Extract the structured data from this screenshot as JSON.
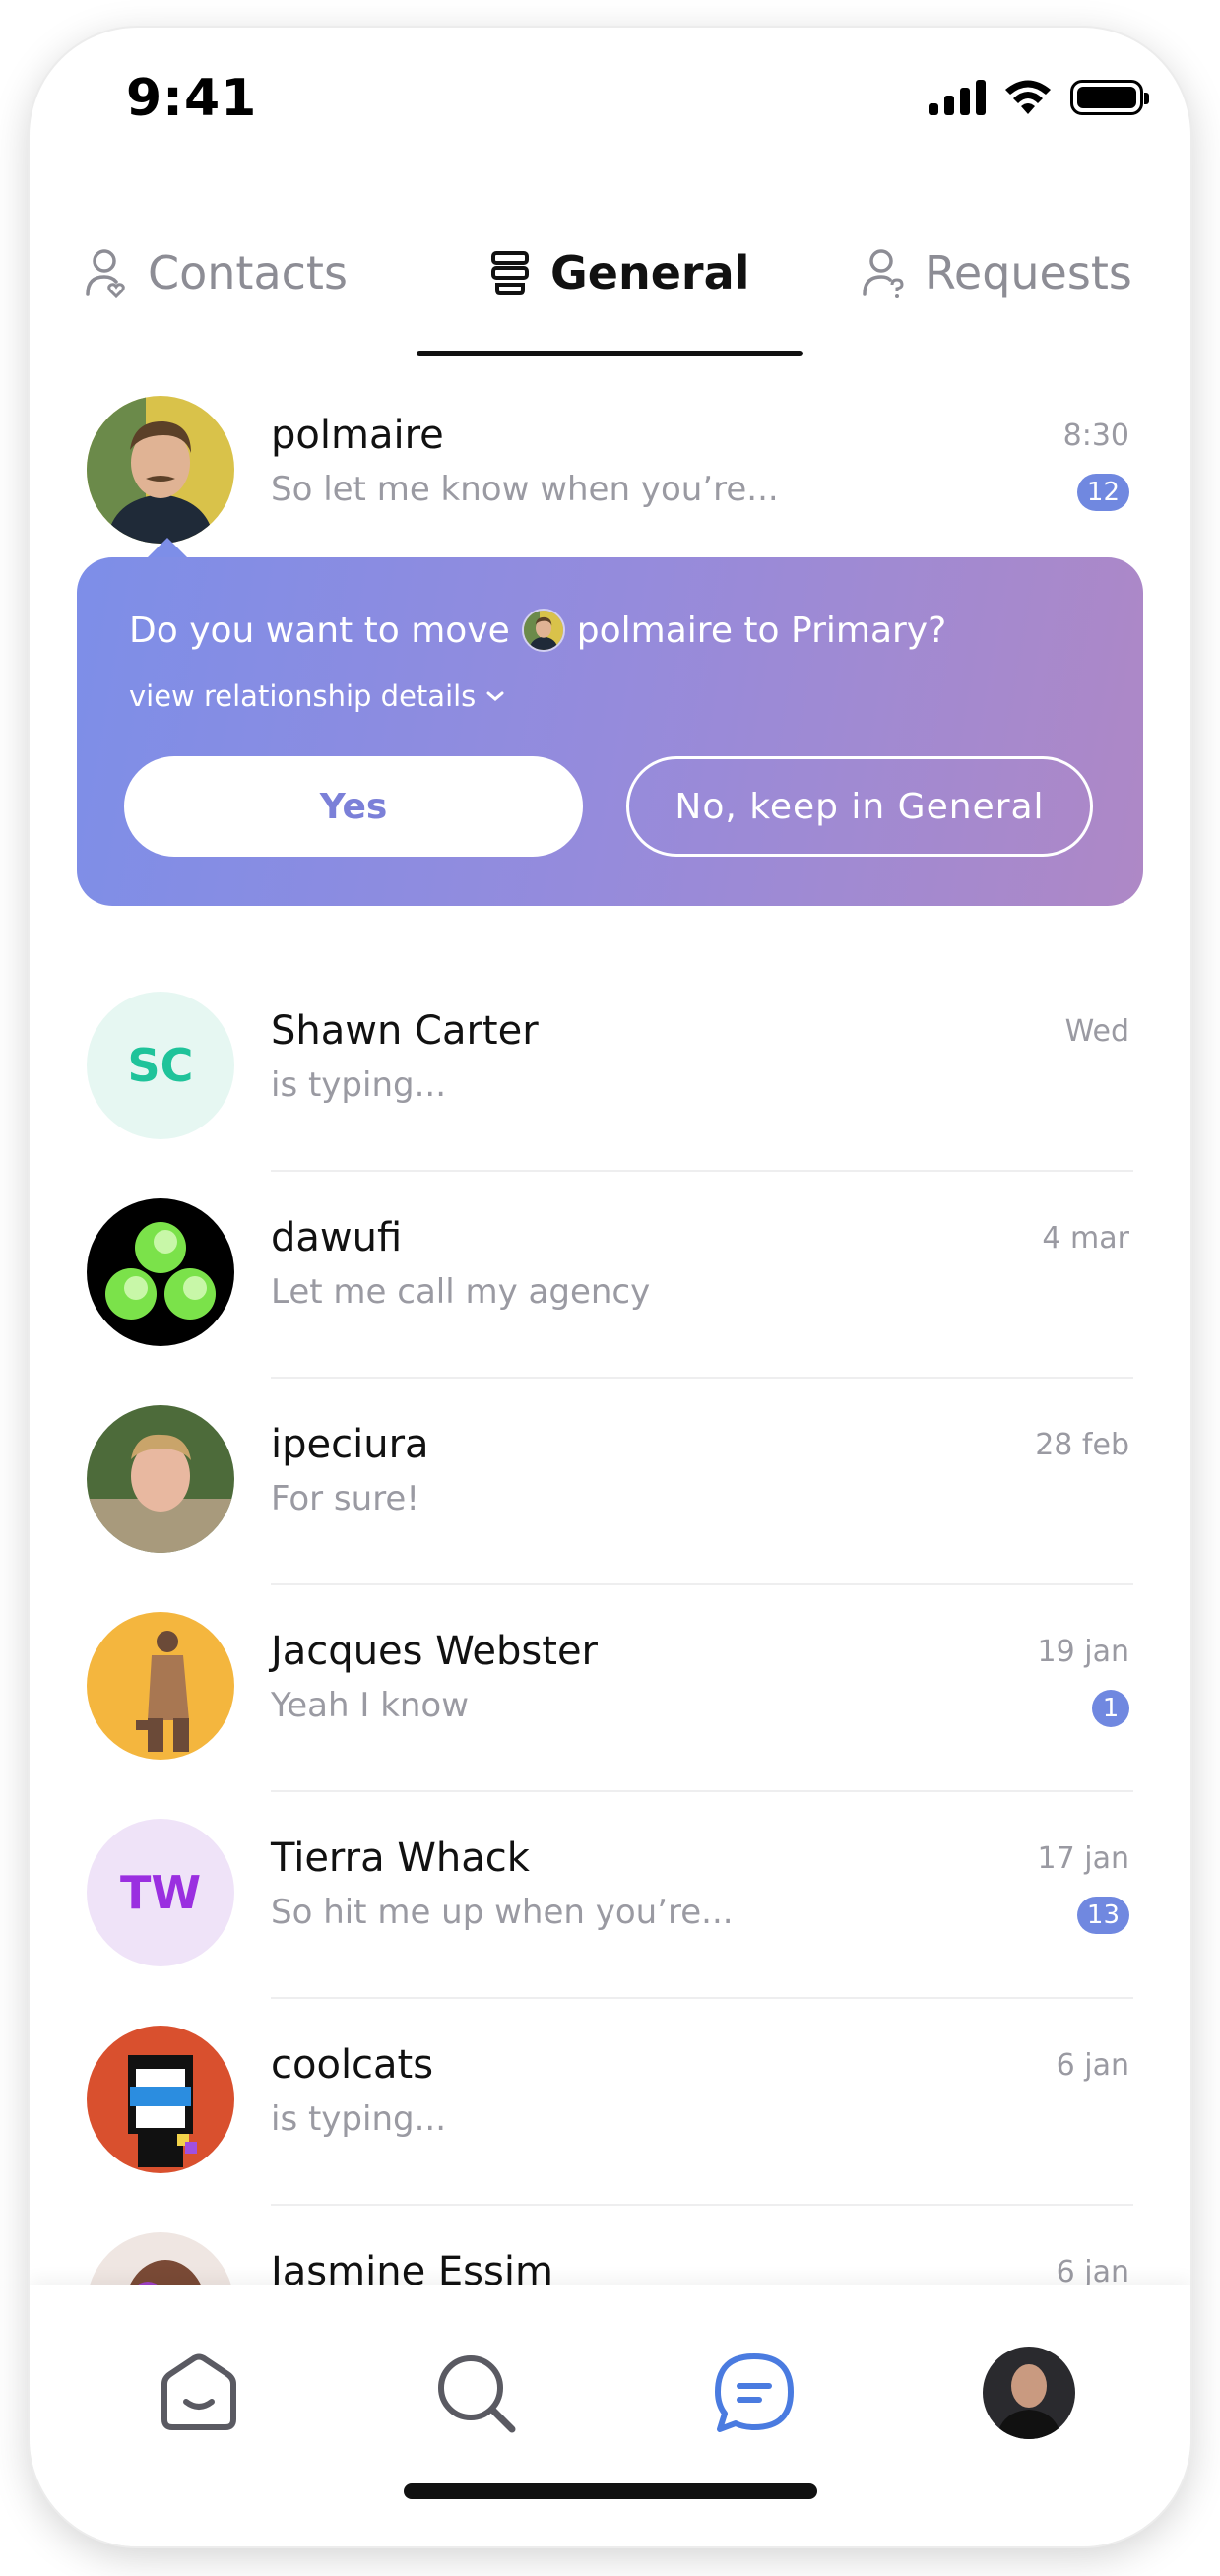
{
  "status_bar": {
    "time": "9:41"
  },
  "tabs": [
    {
      "label": "Contacts",
      "icon": "contacts-icon",
      "active": false
    },
    {
      "label": "General",
      "icon": "stack-icon",
      "active": true
    },
    {
      "label": "Requests",
      "icon": "requests-icon",
      "active": false
    }
  ],
  "first_conversation": {
    "name": "polmaire",
    "preview": "So let me know when you’re...",
    "time": "8:30",
    "unread": "12"
  },
  "prompt": {
    "question_prefix": "Do you want to move",
    "question_suffix": "polmaire to Primary?",
    "details_link": "view relationship details",
    "yes_label": "Yes",
    "no_label": "No, keep in General"
  },
  "conversations": [
    {
      "name": "Shawn Carter",
      "preview": "is typing...",
      "time": "Wed",
      "initials": "SC"
    },
    {
      "name": "dawufi",
      "preview": "Let me call my agency",
      "time": "4 mar"
    },
    {
      "name": "ipeciura",
      "preview": "For sure!",
      "time": "28 feb"
    },
    {
      "name": "Jacques Webster",
      "preview": "Yeah I know",
      "time": "19 jan",
      "unread": "1"
    },
    {
      "name": "Tierra Whack",
      "preview": "So hit me up when you’re...",
      "time": "17 jan",
      "unread": "13",
      "initials": "TW"
    },
    {
      "name": "coolcats",
      "preview": "is typing...",
      "time": "6 jan"
    },
    {
      "name": "Jasmine Essim",
      "preview": "",
      "time": "6 jan"
    }
  ],
  "bottom_nav": [
    {
      "icon": "home-icon",
      "active": false
    },
    {
      "icon": "search-icon",
      "active": false
    },
    {
      "icon": "messages-icon",
      "active": true
    },
    {
      "icon": "profile-avatar",
      "active": false
    }
  ],
  "colors": {
    "accent": "#7088e0",
    "sc_bg": "#e6f7f2",
    "sc_text": "#1fc39a",
    "tw_bg": "#efe3f8",
    "tw_text": "#9a2fe0",
    "active_nav": "#4a7be0"
  }
}
